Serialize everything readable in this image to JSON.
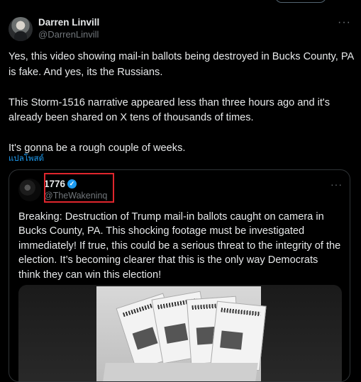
{
  "author": {
    "name": "Darren Linvill",
    "handle": "@DarrenLinvill",
    "more_label": "···"
  },
  "tweet": {
    "paragraphs": [
      "Yes, this video showing mail-in ballots being destroyed in Bucks County, PA is fake. And yes, its the Russians.",
      "This Storm-1516 narrative appeared less than three hours ago and it's already been shared on X tens of thousands of times.",
      "It's gonna be a rough couple of weeks."
    ],
    "translate_link": "แปลโพสต์"
  },
  "quoted": {
    "name": "1776",
    "handle": "@TheWakeninq",
    "verified_glyph": "✓",
    "more_label": "···",
    "text": "Breaking: Destruction of Trump mail-in ballots caught on camera in Bucks County, PA. This shocking footage must be investigated immediately! If true, this could be a serious threat to the integrity of the election. It’s becoming clearer that this is the only way Democrats think they can win this election!"
  },
  "colors": {
    "background": "#000000",
    "text": "#e7e9ea",
    "secondary": "#71767b",
    "link": "#1d9bf0",
    "verified": "#1d9bf0",
    "highlight": "#e0262d"
  }
}
